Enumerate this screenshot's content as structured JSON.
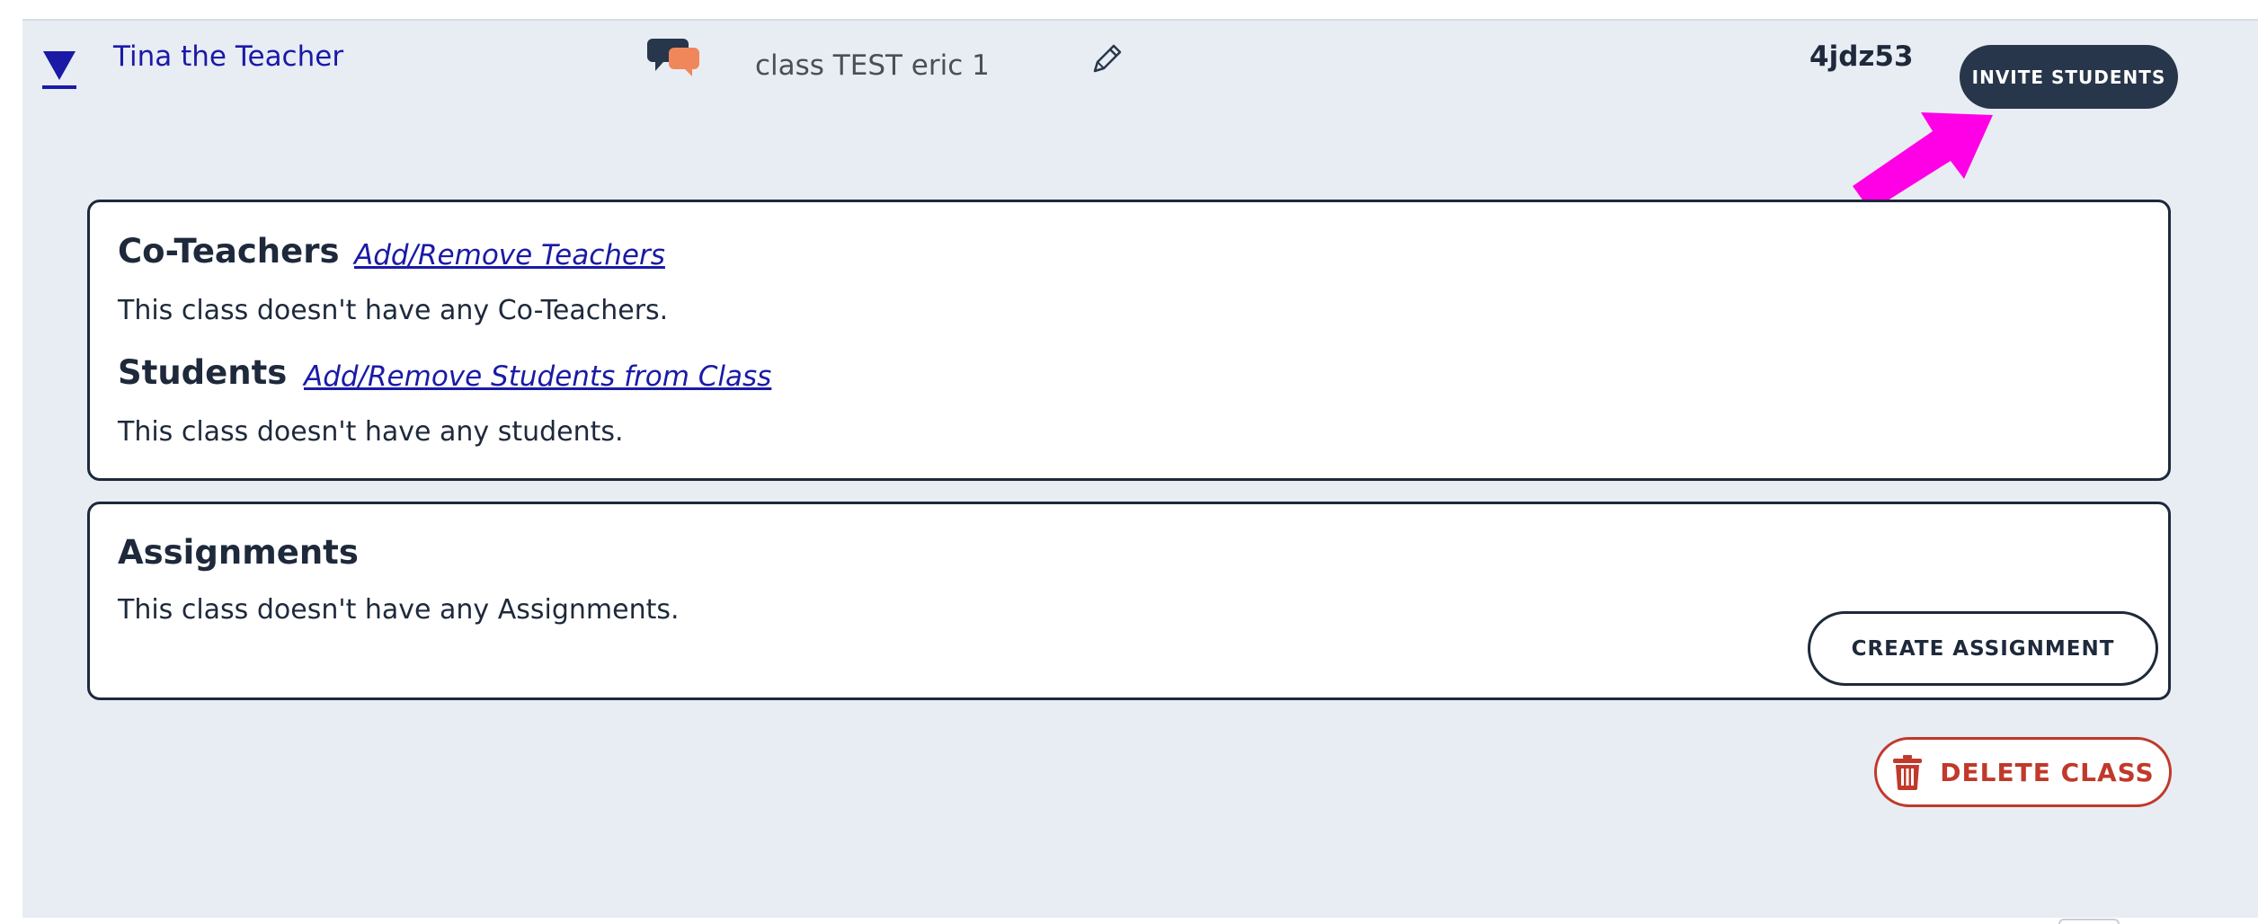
{
  "class_row": {
    "teacher_name": "Tina the Teacher",
    "class_name": "class TEST eric 1",
    "class_code": "4jdz53",
    "invite_label": "INVITE STUDENTS",
    "icons": {
      "expand": "triangle-down-icon",
      "chat": "chat-bubbles-icon",
      "edit": "pencil-icon",
      "annotation": "pink-arrow-annotation"
    }
  },
  "people_card": {
    "coteachers_heading": "Co-Teachers",
    "coteachers_link": "Add/Remove Teachers",
    "coteachers_empty": "This class doesn't have any Co-Teachers.",
    "students_heading": "Students",
    "students_link": "Add/Remove Students from Class",
    "students_empty": "This class doesn't have any students."
  },
  "assignments_card": {
    "heading": "Assignments",
    "empty": "This class doesn't have any Assignments.",
    "create_label": "CREATE ASSIGNMENT"
  },
  "delete_label": "DELETE CLASS",
  "colors": {
    "panel_bg": "#e8edf4",
    "navy": "#27364a",
    "link_blue": "#1a1aa6",
    "danger": "#c0392b",
    "annotation_magenta": "#ff00e6",
    "chat_orange": "#f0875a"
  }
}
